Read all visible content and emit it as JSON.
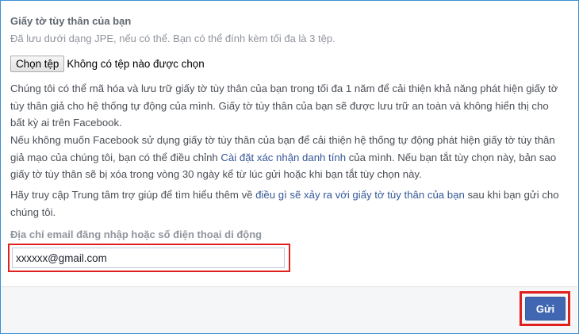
{
  "section": {
    "title": "Giấy tờ tùy thân của bạn",
    "hint": "Đã lưu dưới dạng JPE, nếu có thể. Bạn có thể đính kèm tối đa là 3 tệp."
  },
  "file_upload": {
    "button_label": "Chọn tệp",
    "status": "Không có tệp nào được chọn"
  },
  "paragraphs": {
    "p1": "Chúng tôi có thể mã hóa và lưu trữ giấy tờ tùy thân của bạn trong tối đa 1 năm để cải thiện khả năng phát hiện giấy tờ tùy thân giả cho hệ thống tự động của mình. Giấy tờ tùy thân của bạn sẽ được lưu trữ an toàn và không hiển thị cho bất kỳ ai trên Facebook.",
    "p2_before": "Nếu không muốn Facebook sử dụng giấy tờ tùy thân của bạn để cải thiện hệ thống tự động phát hiện giấy tờ tùy thân giả mạo của chúng tôi, bạn có thể điều chỉnh ",
    "p2_link": "Cài đặt xác nhận danh tính",
    "p2_after": " của mình. Nếu bạn tắt tùy chọn này, bản sao giấy tờ tùy thân sẽ bị xóa trong vòng 30 ngày kể từ lúc gửi hoặc khi bạn tắt tùy chọn này.",
    "p3_before": "Hãy truy cập Trung tâm trợ giúp để tìm hiểu thêm về ",
    "p3_link": "điều gì sẽ xảy ra với giấy tờ tùy thân của bạn",
    "p3_after": " sau khi bạn gửi cho chúng tôi."
  },
  "email": {
    "label": "Địa chỉ email đăng nhập hoặc số điện thoại di động",
    "value": "xxxxxx@gmail.com"
  },
  "footer": {
    "submit_label": "Gửi"
  },
  "colors": {
    "link": "#365899",
    "primary_button": "#4267b2",
    "highlight_border": "#e0201d"
  }
}
